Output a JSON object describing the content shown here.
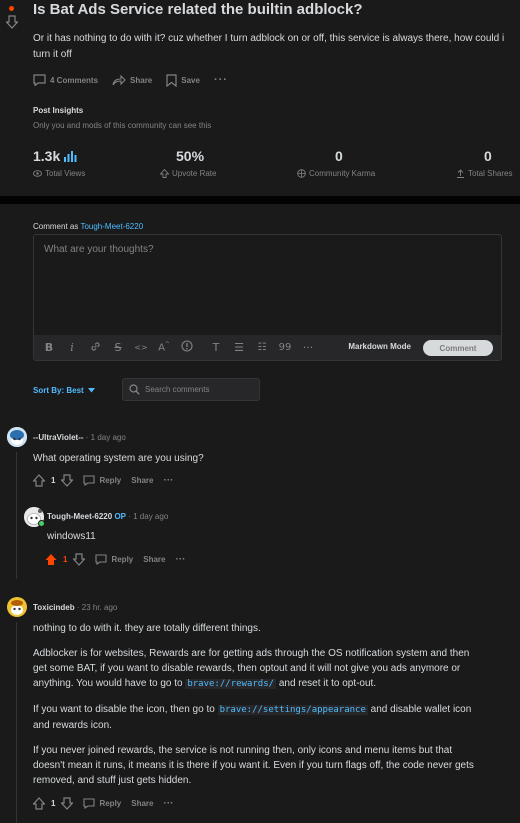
{
  "post": {
    "title": "Is Bat Ads Service related the builtin adblock?",
    "body": "Or it has nothing to do with it? cuz whether I turn adblock on or off, this service is always there, how could i turn it off",
    "actions": {
      "comments": "4 Comments",
      "share": "Share",
      "save": "Save"
    },
    "insights": {
      "title": "Post Insights",
      "subtitle": "Only you and mods of this community can see this",
      "stats": [
        {
          "value": "1.3k",
          "label": "Total Views"
        },
        {
          "value": "50%",
          "label": "Upvote Rate"
        },
        {
          "value": "0",
          "label": "Community Karma"
        },
        {
          "value": "0",
          "label": "Total Shares"
        }
      ]
    }
  },
  "composer": {
    "comment_as_prefix": "Comment as",
    "username": "Tough-Meet-6220",
    "placeholder": "What are your thoughts?",
    "markdown_mode": "Markdown Mode",
    "submit_label": "Comment"
  },
  "sort": {
    "label": "Sort By: Best"
  },
  "search": {
    "placeholder": "Search comments"
  },
  "comments": [
    {
      "author": "--UltraViolet--",
      "time": "· 1 day ago",
      "text": "What operating system are you using?",
      "score": "1",
      "reply": "Reply",
      "share": "Share"
    },
    {
      "author": "Tough-Meet-6220",
      "op": "OP",
      "time": "· 1 day ago",
      "text": "windows11",
      "score": "1",
      "reply": "Reply",
      "share": "Share"
    },
    {
      "author": "Toxicindeb",
      "time": "· 23 hr. ago",
      "paragraphs": {
        "p1": "nothing to do with it. they are totally different things.",
        "p2a": "Adblocker is for websites, Rewards are for getting ads through the OS notification system and then get some BAT, if you want to disable rewards, then optout and it will not give you ads anymore or anything. You would have to go to ",
        "p2code": "brave://rewards/",
        "p2b": " and reset it to opt-out.",
        "p3a": "If you want to disable the icon, then go to ",
        "p3code": "brave://settings/appearance",
        "p3b": " and disable wallet icon and rewards icon.",
        "p4": "If you never joined rewards, the service is not running then, only icons and menu items but that doesn't mean it runs, it means it is there if you want it. Even if you turn flags off, the code never gets removed, and stuff just gets hidden."
      },
      "score": "1",
      "reply": "Reply",
      "share": "Share"
    }
  ],
  "colors": {
    "accent": "#4fbcff",
    "upvote": "#ff4500",
    "background": "#1a1a1b",
    "text": "#d7dadc",
    "muted": "#818384"
  }
}
